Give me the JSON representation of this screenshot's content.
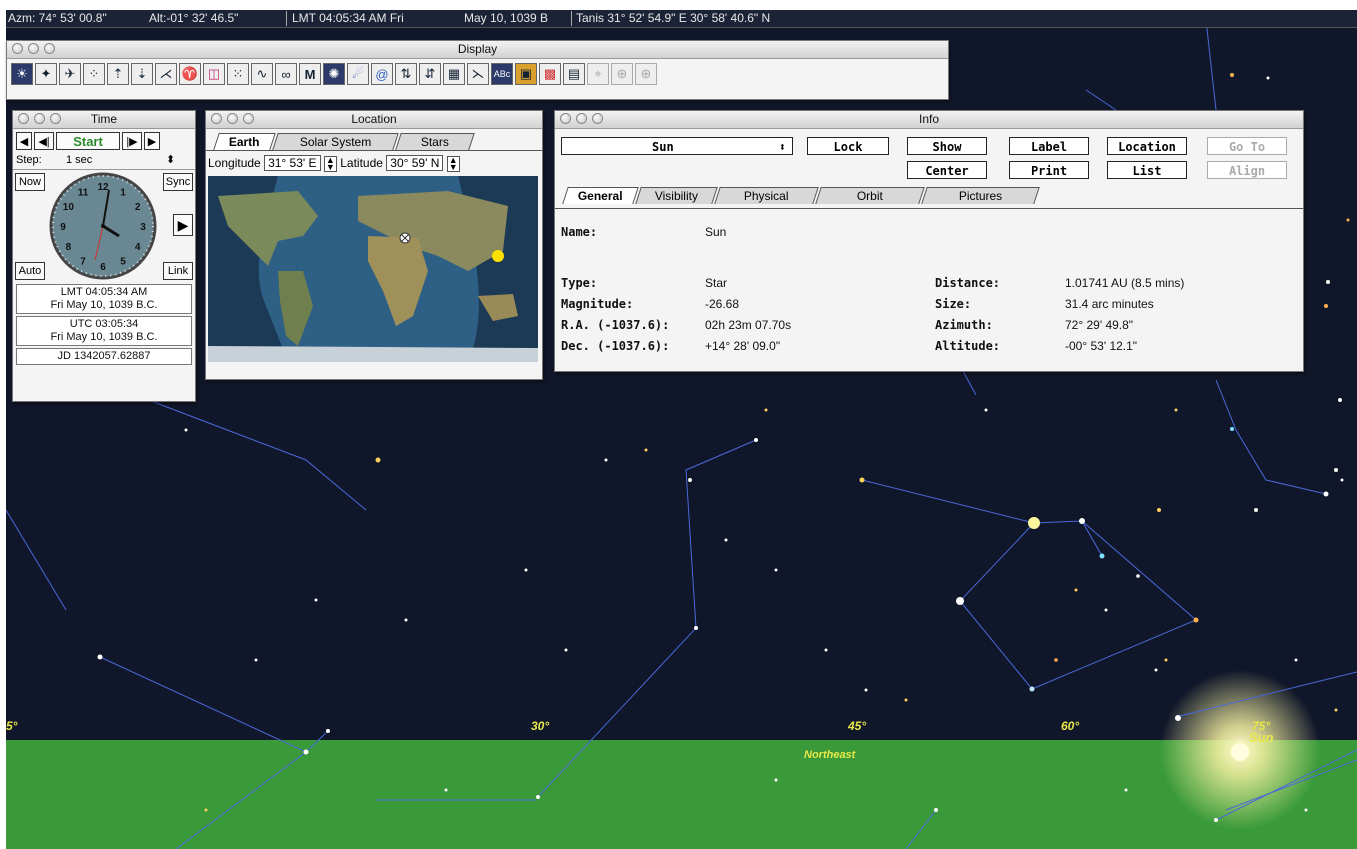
{
  "status": {
    "azimuth": "Azm: 74° 53' 00.8\"",
    "altitude": "Alt:-01° 32' 46.5\"",
    "lmt": "LMT 04:05:34 AM  Fri",
    "date": "May 10, 1039 B",
    "location": "Tanis   31° 52' 54.9\" E   30° 58' 40.6\" N"
  },
  "display_window": {
    "title": "Display",
    "tools": [
      "solar-system-icon",
      "stars-icon",
      "planets-icon",
      "deep-sky-icon",
      "sort-up-icon",
      "sort-down-icon",
      "constellation-lines-icon",
      "constellation-figures-icon",
      "boundaries-icon",
      "star-names-icon",
      "milky-way-icon",
      "binoculars-icon",
      "messier-icon",
      "galaxy-icon",
      "comet-icon",
      "spiral-icon",
      "sort-az-icon",
      "sort-za-icon",
      "grid-icon",
      "horizon-icon",
      "labels-icon",
      "photo-icon",
      "color-icon",
      "panel-icon",
      "telescope-icon",
      "zoom-in-icon",
      "zoom-out-icon"
    ]
  },
  "time_window": {
    "title": "Time",
    "start_label": "Start",
    "step_label": "Step:",
    "step_value": "1 sec",
    "now_label": "Now",
    "sync_label": "Sync",
    "auto_label": "Auto",
    "link_label": "Link",
    "lmt_line1": "LMT 04:05:34 AM",
    "lmt_line2": "Fri May 10, 1039 B.C.",
    "utc_line1": "UTC 03:05:34",
    "utc_line2": "Fri May 10, 1039 B.C.",
    "jd": "JD 1342057.62887",
    "clock_numbers": [
      "12",
      "1",
      "2",
      "3",
      "4",
      "5",
      "6",
      "7",
      "8",
      "9",
      "10",
      "11"
    ]
  },
  "location_window": {
    "title": "Location",
    "tabs": [
      "Earth",
      "Solar System",
      "Stars"
    ],
    "longitude_label": "Longitude",
    "longitude_value": "31° 53' E",
    "latitude_label": "Latitude",
    "latitude_value": "30° 59' N"
  },
  "info_window": {
    "title": "Info",
    "object": "Sun",
    "buttons": {
      "lock": "Lock",
      "show": "Show",
      "label": "Label",
      "location": "Location",
      "goto": "Go To",
      "center": "Center",
      "print": "Print",
      "list": "List",
      "align": "Align"
    },
    "tabs": [
      "General",
      "Visibility",
      "Physical",
      "Orbit",
      "Pictures"
    ],
    "name_label": "Name:",
    "name_value": "Sun",
    "type_label": "Type:",
    "type_value": "Star",
    "mag_label": "Magnitude:",
    "mag_value": "-26.68",
    "ra_label": "R.A. (-1037.6):",
    "ra_value": "02h 23m 07.70s",
    "dec_label": "Dec. (-1037.6):",
    "dec_value": "+14° 28' 09.0\"",
    "dist_label": "Distance:",
    "dist_value": "1.01741 AU (8.5 mins)",
    "size_label": "Size:",
    "size_value": "31.4 arc minutes",
    "az_label": "Azimuth:",
    "az_value": "72° 29' 49.8\"",
    "alt_label": "Altitude:",
    "alt_value": "-00° 53' 12.1\""
  },
  "sky": {
    "azimuth_ticks": [
      "5°",
      "30°",
      "45°",
      "60°",
      "75°"
    ],
    "direction_label": "Northeast",
    "sun_label": "Sun",
    "colors": {
      "sky": "#11172a",
      "ground": "#3a9a3a",
      "lines": "#4a68d8",
      "labels": "#e8e84a"
    }
  }
}
